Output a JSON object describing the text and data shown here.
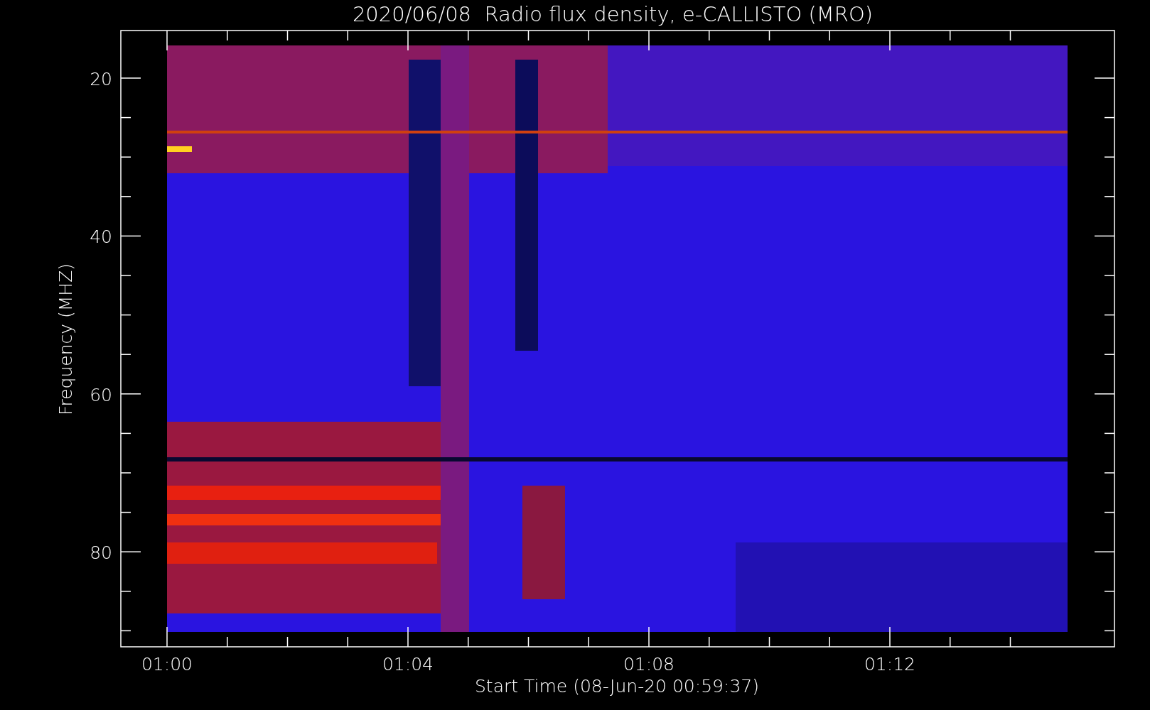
{
  "title": "2020/06/08  Radio flux density, e-CALLISTO (MRO)",
  "y_axis": {
    "label": "Frequency (MHZ)",
    "tick_labels": [
      "20",
      "40",
      "60",
      "80"
    ]
  },
  "x_axis": {
    "label": "Start Time (08-Jun-20 00:59:37)",
    "tick_labels": [
      "01:00",
      "01:04",
      "01:08",
      "01:12"
    ]
  }
}
